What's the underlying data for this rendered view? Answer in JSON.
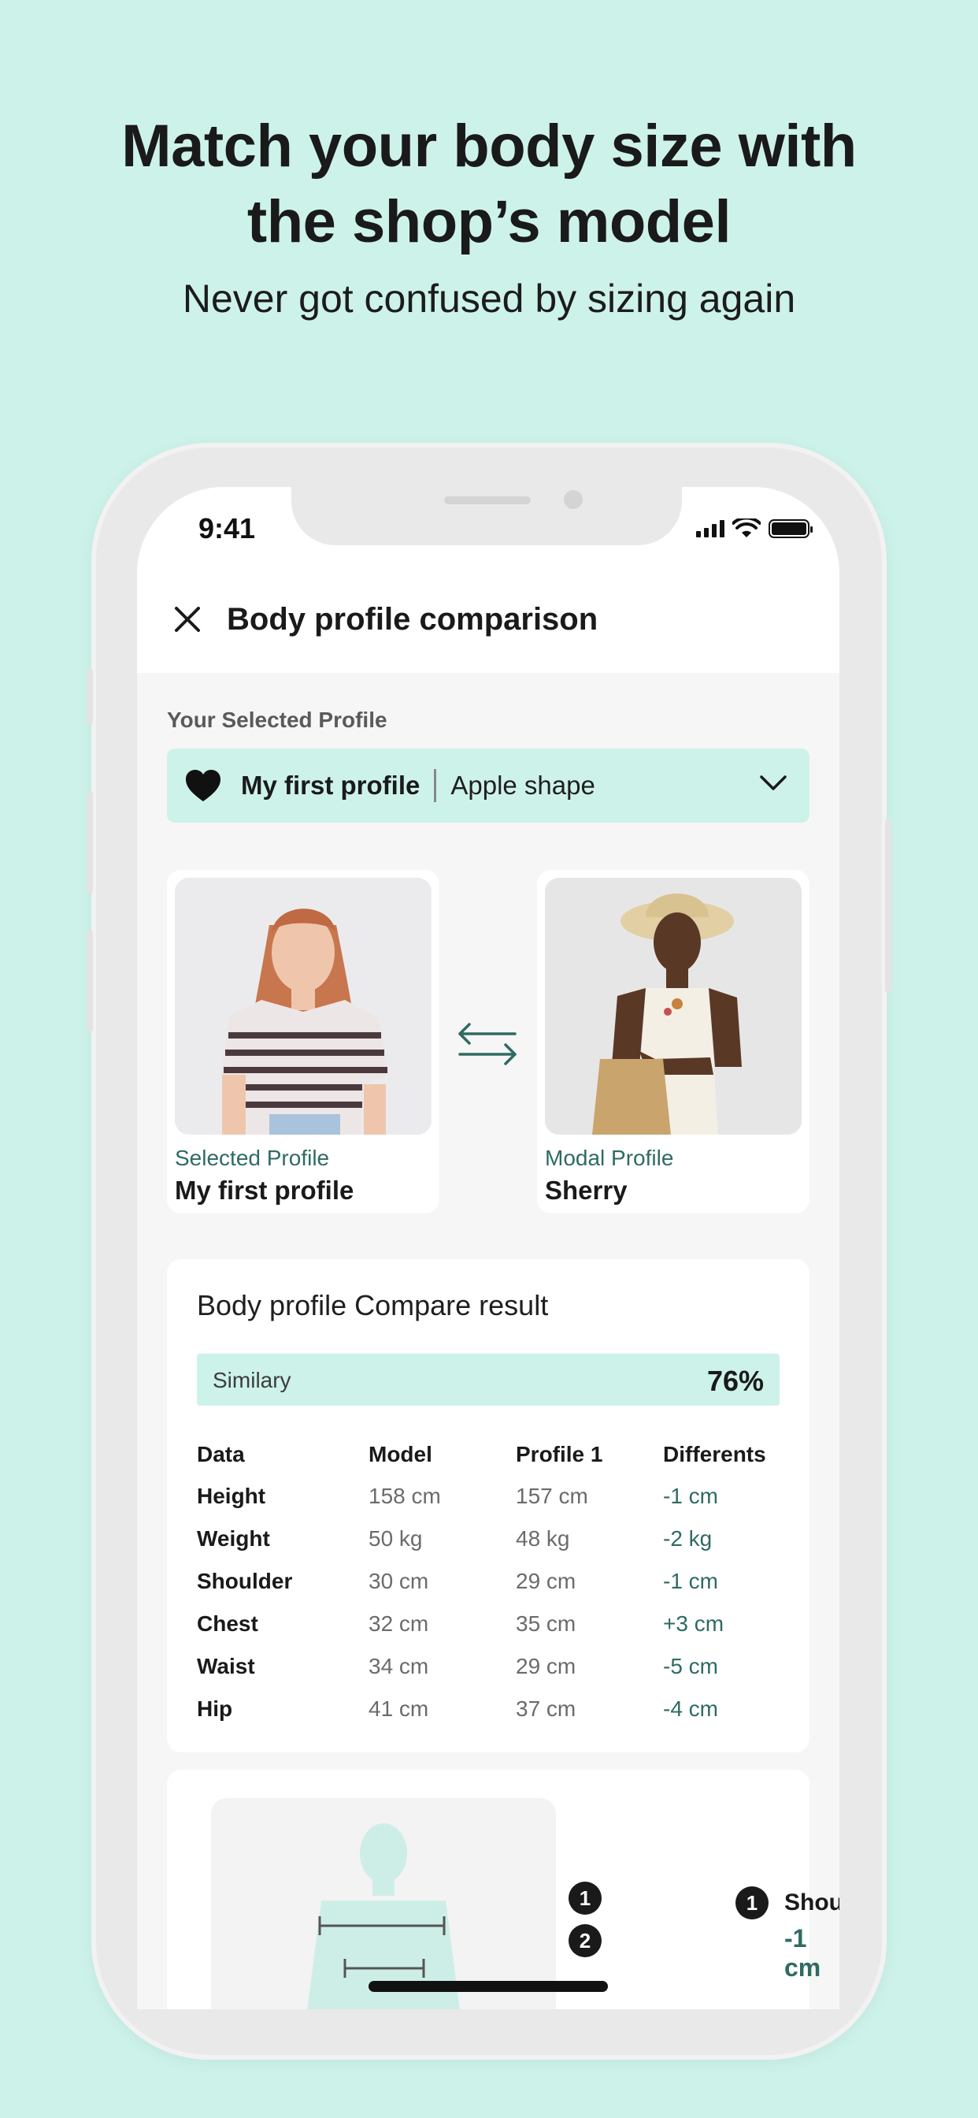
{
  "promo": {
    "headline_line1": "Match your body size with",
    "headline_line2": "the shop’s model",
    "subheadline": "Never got confused by sizing again"
  },
  "status_bar": {
    "time": "9:41"
  },
  "nav": {
    "title": "Body profile comparison",
    "close_icon": "close-icon"
  },
  "profile_selector": {
    "label": "Your Selected Profile",
    "profile_name": "My first profile",
    "shape": "Apple shape",
    "icon": "heart-icon"
  },
  "comparison": {
    "selected": {
      "caption": "Selected Profile",
      "name": "My first profile"
    },
    "model": {
      "caption": "Modal Profile",
      "name": "Sherry"
    },
    "swap_icon": "swap-arrows-icon"
  },
  "result": {
    "title": "Body profile Compare result",
    "similarity_label": "Similary",
    "similarity_value": "76%",
    "headers": [
      "Data",
      "Model",
      "Profile 1",
      "Differents"
    ],
    "rows": [
      [
        "Height",
        "158 cm",
        "157 cm",
        "-1 cm"
      ],
      [
        "Weight",
        "50 kg",
        "48 kg",
        "-2 kg"
      ],
      [
        "Shoulder",
        "30 cm",
        "29 cm",
        "-1 cm"
      ],
      [
        "Chest",
        "32 cm",
        "35 cm",
        "+3 cm"
      ],
      [
        "Waist",
        "34 cm",
        "29 cm",
        "-5 cm"
      ],
      [
        "Hip",
        "41 cm",
        "37 cm",
        "-4 cm"
      ]
    ]
  },
  "measure": {
    "marker1": "1",
    "marker2": "2",
    "legend_num": "1",
    "legend_label": "Shoulder",
    "legend_value": "-1 cm"
  },
  "colors": {
    "mint": "#cdf2ea",
    "teal_text": "#2f6b63",
    "dark": "#1a1a1a"
  }
}
